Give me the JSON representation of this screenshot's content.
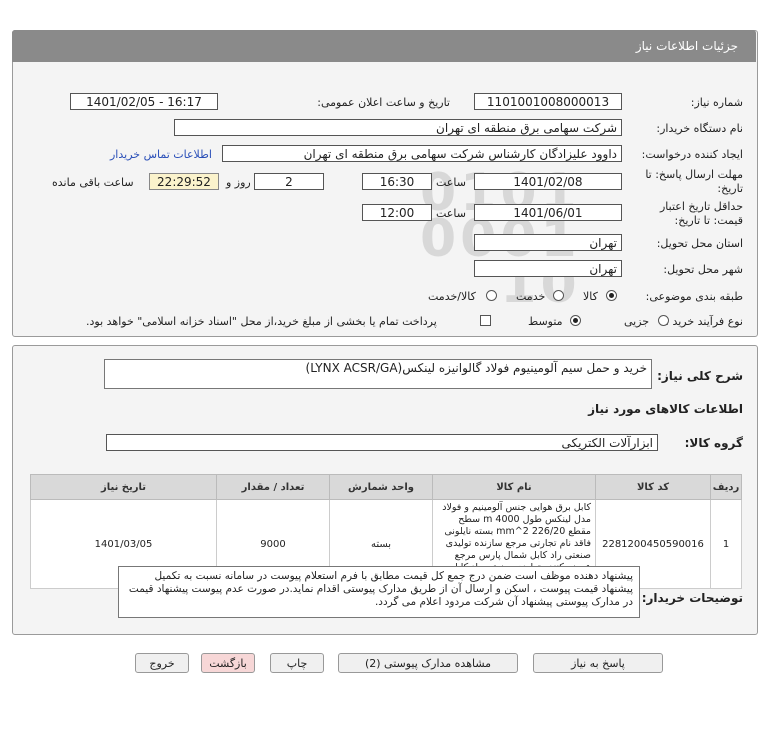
{
  "header": {
    "title": "جزئیات اطلاعات نیاز"
  },
  "form": {
    "need_number_label": "شماره نیاز:",
    "need_number": "1101001008000013",
    "announce_label": "تاریخ و ساعت اعلان عمومی:",
    "announce_value": "1401/02/05 - 16:17",
    "buyer_org_label": "نام دستگاه خریدار:",
    "buyer_org": "شرکت سهامی برق منطقه ای تهران",
    "creator_label": "ایجاد کننده درخواست:",
    "creator": "داوود علیزادگان  کارشناس شرکت سهامی برق منطقه ای تهران",
    "contact_link": "اطلاعات تماس خریدار",
    "deadline_label": "مهلت ارسال پاسخ: تا تاریخ:",
    "deadline_date": "1401/02/08",
    "time_label": "ساعت",
    "deadline_time": "16:30",
    "days_value": "2",
    "days_label": "روز و",
    "remaining_time": "22:29:52",
    "remaining_label": "ساعت باقی مانده",
    "validity_label": "حداقل تاریخ اعتبار قیمت: تا تاریخ:",
    "validity_date": "1401/06/01",
    "validity_time_label": "ساعت",
    "validity_time": "12:00",
    "province_label": "استان محل تحویل:",
    "province": "تهران",
    "city_label": "شهر محل تحویل:",
    "city": "تهران",
    "category_label": "طبقه بندی موضوعی:",
    "category_options": [
      "کالا",
      "خدمت",
      "کالا/خدمت"
    ],
    "process_label": "نوع فرآیند خرید :",
    "process_options": [
      "جزیی",
      "متوسط"
    ],
    "payment_note": "پرداخت تمام یا بخشی از مبلغ خرید،از محل \"اسناد خزانه اسلامی\" خواهد بود."
  },
  "details": {
    "summary_label": "شرح کلی نیاز:",
    "summary": "خرید و حمل سیم آلومینیوم فولاد گالوانیزه لینکس(LYNX ACSR/GA)",
    "goods_info_title": "اطلاعات کالاهای مورد نیاز",
    "group_label": "گروه کالا:",
    "group_value": "ابزارآلات الکتریکی",
    "table": {
      "headers": [
        "ردیف",
        "کد کالا",
        "نام کالا",
        "واحد شمارش",
        "تعداد / مقدار",
        "تاریخ نیاز"
      ],
      "rows": [
        {
          "row": "1",
          "code": "2281200450590016",
          "name": "کابل برق هوایی جنس آلومینیم و فولاد مدل لینکس طول 4000 m سطح مقطع 226/20 mm^2 بسته نایلونی فاقد نام تجارتی مرجع سازنده تولیدی صنعتی راد کابل شمال پارس مرجع عرضه کننده تولیدی صنعتی راد کابل شمال پارس",
          "unit": "بسته",
          "qty": "9000",
          "date": "1401/03/05"
        }
      ]
    },
    "buyer_notes_label": "توضیحات خریدار:",
    "buyer_notes": "پیشنهاد دهنده موظف است ضمن درج جمع کل قیمت مطابق با فرم استعلام پیوست در سامانه نسبت به تکمیل پیشنهاد قیمت پیوست ، اسکن و ارسال آن از طریق مدارک پیوستی اقدام نماید.در صورت عدم پیوست پیشنهاد قیمت در مدارک پیوستی پیشنهاد آن شرکت مردود اعلام می گردد."
  },
  "buttons": {
    "reply": "پاسخ به نیاز",
    "attachments": "مشاهده مدارک پیوستی (2)",
    "print": "چاپ",
    "back": "بازگشت",
    "exit": "خروج"
  },
  "watermark": {
    "brand": "ParsNamadData"
  },
  "colors": {
    "header_bg": "#8a8a8a",
    "link": "#2a4fb8",
    "remaining_bg": "#fbf3cc",
    "back_btn_bg": "#f7d7d7"
  }
}
